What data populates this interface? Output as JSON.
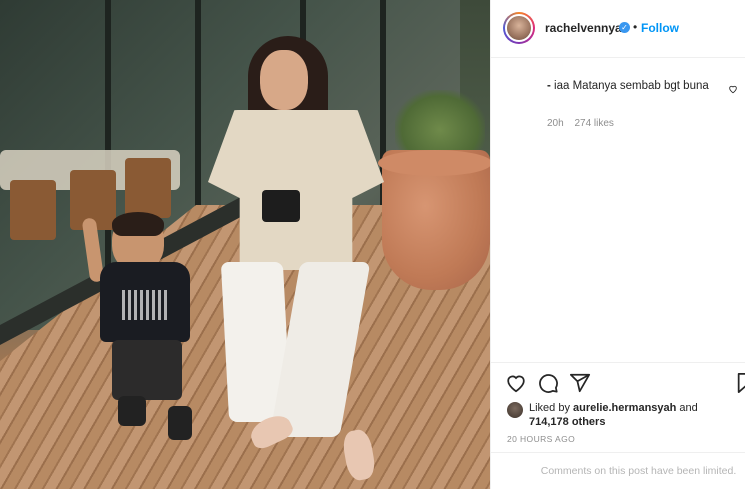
{
  "post": {
    "username": "rachelvennya",
    "verified_mark": "✓",
    "separator": "•",
    "follow_label": "Follow"
  },
  "comment": {
    "user": "-",
    "text": "iaa Matanya sembab bgt buna",
    "age": "20h",
    "likes": "274 likes"
  },
  "icons": {
    "verified": "verified-badge-icon",
    "comment_like": "heart-icon",
    "like": "heart-icon",
    "comment": "comment-bubble-icon",
    "share": "paper-plane-icon",
    "save": "bookmark-icon"
  },
  "likes": {
    "prefix": "Liked by ",
    "user": "aurelie.hermansyah",
    "middle": " and ",
    "count": "714,178 others"
  },
  "timestamp": "20 HOURS AGO",
  "comments_limited": "Comments on this post have been limited.",
  "colors": {
    "accent": "#0095f6",
    "text": "#262626",
    "muted": "#8e8e8e",
    "border": "#efefef"
  }
}
